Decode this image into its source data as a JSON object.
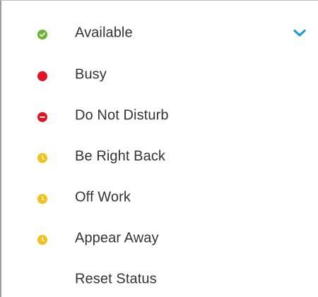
{
  "colors": {
    "available": "#6bb32e",
    "busy": "#e81123",
    "away": "#f3c118",
    "chevron": "#1f9ad6",
    "text": "#333333"
  },
  "status_menu": {
    "expand_icon": "chevron-down-icon",
    "items": [
      {
        "label": "Available",
        "icon": "available-check-icon"
      },
      {
        "label": "Busy",
        "icon": "busy-dot-icon"
      },
      {
        "label": "Do Not Disturb",
        "icon": "do-not-disturb-icon"
      },
      {
        "label": "Be Right Back",
        "icon": "clock-icon"
      },
      {
        "label": "Off Work",
        "icon": "clock-icon"
      },
      {
        "label": "Appear Away",
        "icon": "clock-icon"
      },
      {
        "label": "Reset Status"
      }
    ]
  }
}
